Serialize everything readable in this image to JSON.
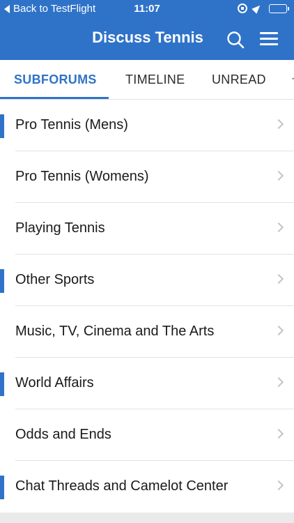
{
  "statusbar": {
    "back_label": "Back to TestFlight",
    "time": "11:07",
    "battery_level": 0.45
  },
  "header": {
    "title": "Discuss Tennis",
    "search_icon": "search-icon",
    "menu_icon": "hamburger-menu-icon"
  },
  "tabs": [
    {
      "label": "SUBFORUMS",
      "active": true
    },
    {
      "label": "TIMELINE",
      "active": false
    },
    {
      "label": "UNREAD",
      "active": false
    }
  ],
  "forums": [
    {
      "label": "Pro Tennis (Mens)",
      "unread_marker": true
    },
    {
      "label": "Pro Tennis (Womens)",
      "unread_marker": false
    },
    {
      "label": "Playing Tennis",
      "unread_marker": false
    },
    {
      "label": "Other Sports",
      "unread_marker": true
    },
    {
      "label": "Music, TV, Cinema and The Arts",
      "unread_marker": false
    },
    {
      "label": "World Affairs",
      "unread_marker": true
    },
    {
      "label": "Odds and Ends",
      "unread_marker": false
    },
    {
      "label": "Chat Threads and Camelot Center",
      "unread_marker": true
    }
  ],
  "colors": {
    "accent": "#2f73c9",
    "separator": "#e2e2e2",
    "chevron": "#c4c4c8"
  }
}
